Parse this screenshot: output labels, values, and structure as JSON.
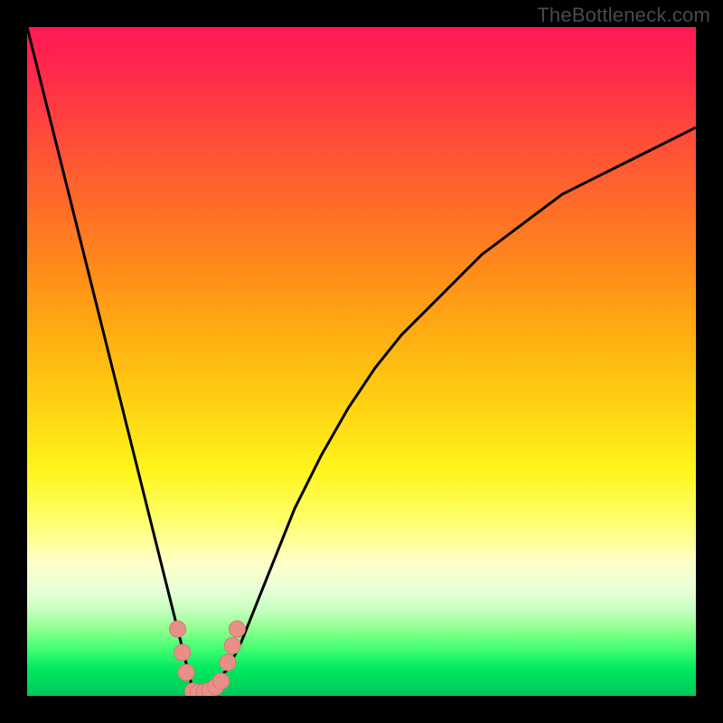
{
  "watermark": "TheBottleneck.com",
  "colors": {
    "frame": "#000000",
    "curve_stroke": "#000000",
    "marker_fill": "#e98f88",
    "marker_stroke": "#d77a72"
  },
  "chart_data": {
    "type": "line",
    "title": "",
    "xlabel": "",
    "ylabel": "",
    "xlim": [
      0,
      100
    ],
    "ylim": [
      0,
      100
    ],
    "grid": false,
    "legend": false,
    "comment": "Bottleneck-style V curve; y is bottleneck percentage (0 at optimum ~x=25). No numeric axes are rendered in the source image; values below are estimated from pixel positions.",
    "x": [
      0,
      2,
      4,
      6,
      8,
      10,
      12,
      14,
      16,
      18,
      20,
      21,
      22,
      23,
      24,
      25,
      26,
      27,
      28,
      29,
      30,
      32,
      34,
      36,
      38,
      40,
      44,
      48,
      52,
      56,
      60,
      64,
      68,
      72,
      76,
      80,
      84,
      88,
      92,
      96,
      100
    ],
    "y": [
      100,
      92,
      84,
      76,
      68,
      60,
      52,
      44,
      36,
      28,
      20,
      16,
      12,
      8,
      4,
      0,
      1,
      1,
      2,
      3,
      4,
      8,
      13,
      18,
      23,
      28,
      36,
      43,
      49,
      54,
      58,
      62,
      66,
      69,
      72,
      75,
      77,
      79,
      81,
      83,
      85
    ],
    "markers": [
      {
        "x": 22.5,
        "y": 10.0
      },
      {
        "x": 23.2,
        "y": 6.5
      },
      {
        "x": 23.8,
        "y": 3.5
      },
      {
        "x": 24.8,
        "y": 0.7
      },
      {
        "x": 25.6,
        "y": 0.5
      },
      {
        "x": 26.5,
        "y": 0.6
      },
      {
        "x": 27.3,
        "y": 0.8
      },
      {
        "x": 28.2,
        "y": 1.4
      },
      {
        "x": 29.0,
        "y": 2.2
      },
      {
        "x": 30.0,
        "y": 5.0
      },
      {
        "x": 30.7,
        "y": 7.5
      },
      {
        "x": 31.4,
        "y": 10.0
      }
    ]
  }
}
